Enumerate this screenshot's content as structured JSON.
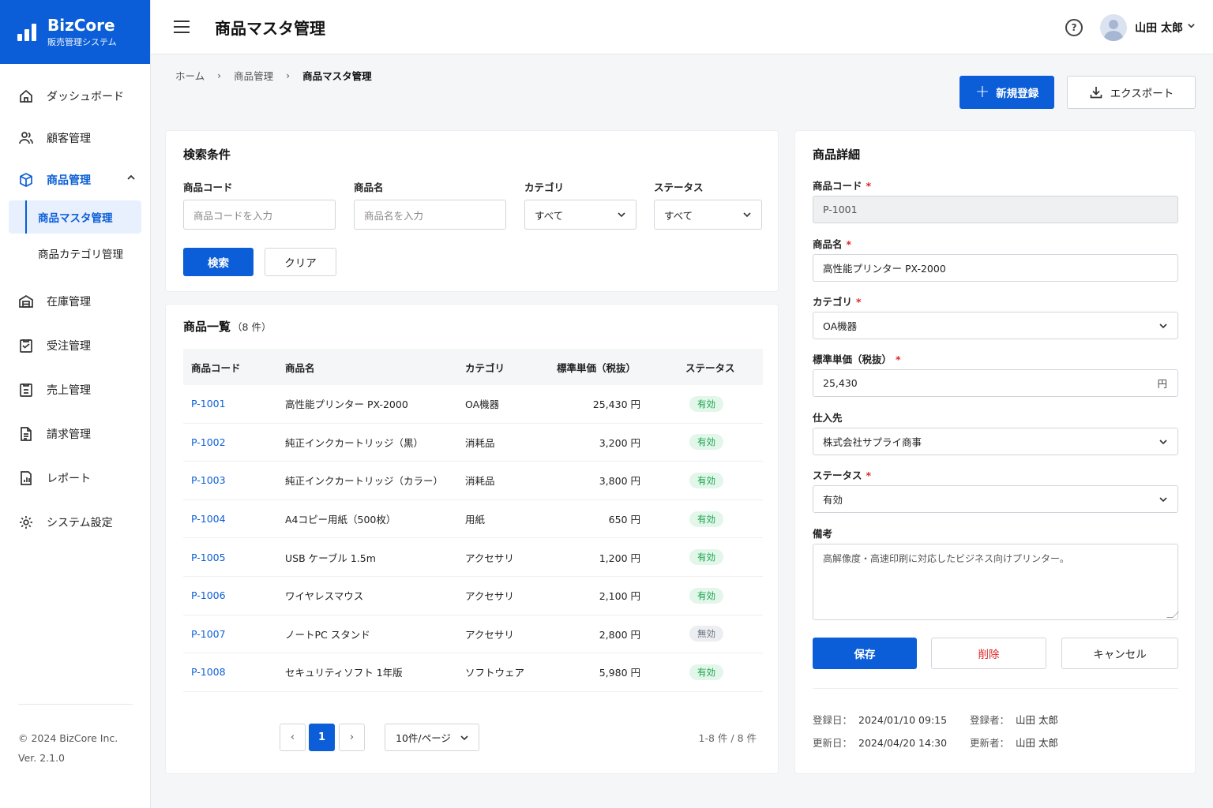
{
  "app": {
    "brand": "BizCore",
    "subtitle": "販売管理システム",
    "copyright": "© 2024 BizCore Inc.",
    "version": "Ver. 2.1.0"
  },
  "nav": {
    "items": [
      {
        "label": "ダッシュボード",
        "icon": "home-icon"
      },
      {
        "label": "顧客管理",
        "icon": "users-icon"
      },
      {
        "label": "商品管理",
        "icon": "box-icon"
      },
      {
        "label": "在庫管理",
        "icon": "warehouse-icon"
      },
      {
        "label": "受注管理",
        "icon": "order-icon"
      },
      {
        "label": "売上管理",
        "icon": "clipboard-icon"
      },
      {
        "label": "請求管理",
        "icon": "invoice-icon"
      },
      {
        "label": "レポート",
        "icon": "report-icon"
      },
      {
        "label": "システム設定",
        "icon": "gear-icon"
      }
    ],
    "sub_items": [
      "商品マスタ管理",
      "商品カテゴリ管理"
    ]
  },
  "header": {
    "title": "商品マスタ管理",
    "user": "山田 太郎"
  },
  "breadcrumb": [
    "ホーム",
    "商品管理",
    "商品マスタ管理"
  ],
  "actions": {
    "new": "新規登録",
    "export": "エクスポート"
  },
  "search": {
    "title": "検索条件",
    "code_label": "商品コード",
    "code_placeholder": "商品コードを入力",
    "name_label": "商品名",
    "name_placeholder": "商品名を入力",
    "category_label": "カテゴリ",
    "category_value": "すべて",
    "status_label": "ステータス",
    "status_value": "すべて",
    "search_btn": "検索",
    "clear_btn": "クリア"
  },
  "list": {
    "title": "商品一覧",
    "count": "（8 件）",
    "columns": [
      "商品コード",
      "商品名",
      "カテゴリ",
      "標準単価（税抜）",
      "ステータス"
    ],
    "rows": [
      {
        "code": "P-1001",
        "name": "高性能プリンター PX-2000",
        "category": "OA機器",
        "price": "25,430 円",
        "status": "有効",
        "active": true
      },
      {
        "code": "P-1002",
        "name": "純正インクカートリッジ（黒）",
        "category": "消耗品",
        "price": "3,200 円",
        "status": "有効",
        "active": true
      },
      {
        "code": "P-1003",
        "name": "純正インクカートリッジ（カラー）",
        "category": "消耗品",
        "price": "3,800 円",
        "status": "有効",
        "active": true
      },
      {
        "code": "P-1004",
        "name": "A4コピー用紙（500枚）",
        "category": "用紙",
        "price": "650 円",
        "status": "有効",
        "active": true
      },
      {
        "code": "P-1005",
        "name": "USB ケーブル 1.5m",
        "category": "アクセサリ",
        "price": "1,200 円",
        "status": "有効",
        "active": true
      },
      {
        "code": "P-1006",
        "name": "ワイヤレスマウス",
        "category": "アクセサリ",
        "price": "2,100 円",
        "status": "有効",
        "active": true
      },
      {
        "code": "P-1007",
        "name": "ノートPC スタンド",
        "category": "アクセサリ",
        "price": "2,800 円",
        "status": "無効",
        "active": false
      },
      {
        "code": "P-1008",
        "name": "セキュリティソフト 1年版",
        "category": "ソフトウェア",
        "price": "5,980 円",
        "status": "有効",
        "active": true
      }
    ],
    "pager": {
      "prev": "‹",
      "current": "1",
      "next": "›",
      "per_page": "10件/ページ",
      "range": "1-8 件 / 8 件"
    }
  },
  "detail": {
    "title": "商品詳細",
    "code_label": "商品コード",
    "code_value": "P-1001",
    "name_label": "商品名",
    "name_value": "高性能プリンター PX-2000",
    "category_label": "カテゴリ",
    "category_value": "OA機器",
    "price_label": "標準単価（税抜）",
    "price_value": "25,430",
    "price_unit": "円",
    "supplier_label": "仕入先",
    "supplier_value": "株式会社サプライ商事",
    "status_label": "ステータス",
    "status_value": "有効",
    "note_label": "備考",
    "note_value": "高解像度・高速印刷に対応したビジネス向けプリンター。",
    "required_mark": "*",
    "save_btn": "保存",
    "delete_btn": "削除",
    "cancel_btn": "キャンセル",
    "created_label": "登録日：",
    "created_value": "2024/01/10 09:15",
    "created_by_label": "登録者：",
    "created_by_value": "山田 太郎",
    "updated_label": "更新日：",
    "updated_value": "2024/04/20 14:30",
    "updated_by_label": "更新者：",
    "updated_by_value": "山田 太郎"
  },
  "colors": {
    "primary": "#0b5ed7",
    "success": "#16a34a",
    "danger": "#dc2626"
  }
}
